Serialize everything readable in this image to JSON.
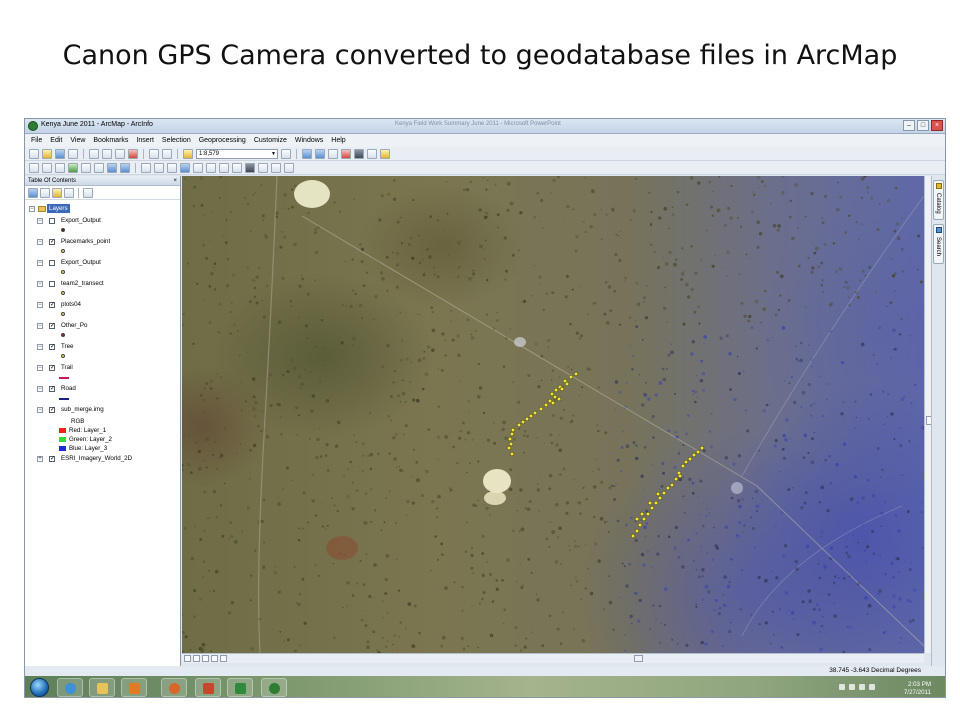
{
  "slide": {
    "title": "Canon GPS Camera converted to geodatabase files in ArcMap"
  },
  "window": {
    "title": "Kenya June 2011 - ArcMap - ArcInfo",
    "ghost_title": "Kenya Field Work Summary June 2011 - Microsoft PowerPoint"
  },
  "menu": [
    "File",
    "Edit",
    "View",
    "Bookmarks",
    "Insert",
    "Selection",
    "Geoprocessing",
    "Customize",
    "Windows",
    "Help"
  ],
  "toolbar": {
    "scale_value": "1:8,579"
  },
  "toc": {
    "header": "Table Of Contents",
    "close_glyph": "× ",
    "root_label": "Layers",
    "layers": [
      {
        "name": "Export_Output",
        "checked": false,
        "symbol": "dot",
        "color": "#5b1a1a"
      },
      {
        "name": "Placemarks_point",
        "checked": true,
        "symbol": "dot",
        "color": "#f2e632"
      },
      {
        "name": "Export_Output",
        "checked": false,
        "symbol": "dot",
        "color": "#f2e632"
      },
      {
        "name": "team2_transect",
        "checked": false,
        "symbol": "dot",
        "color": "#f2e632"
      },
      {
        "name": "plots04",
        "checked": true,
        "symbol": "dot",
        "color": "#f2e632"
      },
      {
        "name": "Other_Po",
        "checked": true,
        "symbol": "dot",
        "color": "#a8182e"
      },
      {
        "name": "Tree",
        "checked": true,
        "symbol": "dot",
        "color": "#f2e632"
      },
      {
        "name": "Trail",
        "checked": true,
        "symbol": "line",
        "color": "#c2185b"
      },
      {
        "name": "Road",
        "checked": true,
        "symbol": "line",
        "color": "#1a237e"
      },
      {
        "name": "sub_merge.img",
        "checked": true,
        "symbol": "none",
        "color": ""
      }
    ],
    "rgb": {
      "label": "RGB",
      "bands": [
        {
          "label": "Red:  Layer_1",
          "color": "#ff1a1a"
        },
        {
          "label": "Green: Layer_2",
          "color": "#33dd33"
        },
        {
          "label": "Blue:  Layer_3",
          "color": "#1a2bd9"
        }
      ]
    },
    "basemap": {
      "name": "ESRI_Imagery_World_2D",
      "checked": true
    }
  },
  "side_tabs": {
    "catalog": "Catalog",
    "search": "Search"
  },
  "status": {
    "coordinates": "38.745  -3.643 Decimal Degrees"
  },
  "taskbar": {
    "time": "2:03 PM",
    "date": "7/27/2011"
  },
  "colors": {
    "gps_point": "#f2e632",
    "map_blue_zone": "#5f68a8"
  }
}
